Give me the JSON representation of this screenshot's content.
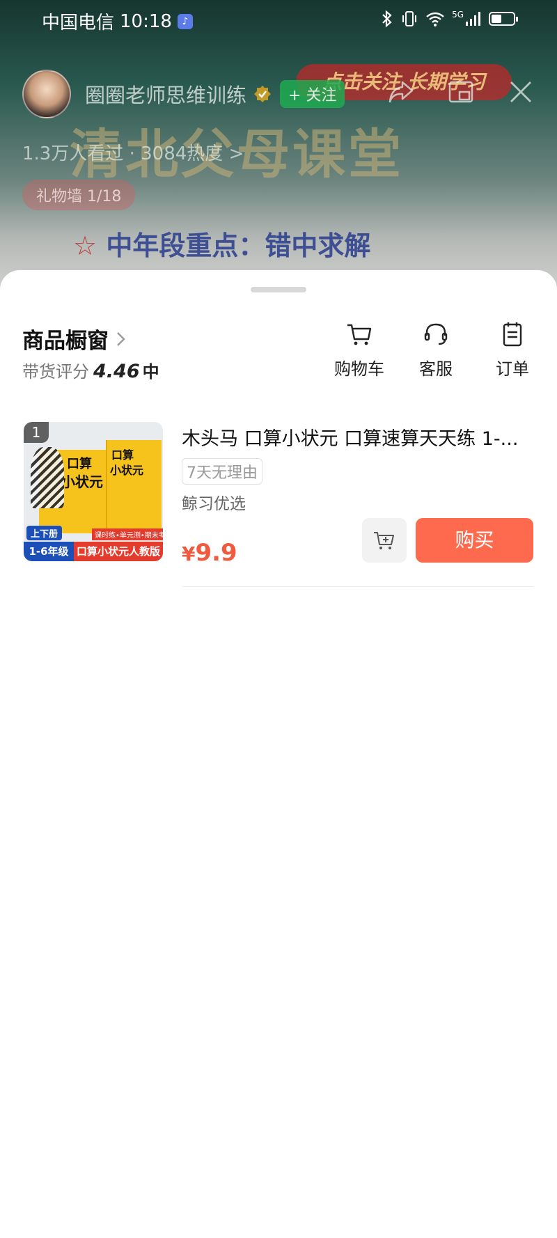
{
  "status_bar": {
    "carrier": "中国电信",
    "time": "10:18",
    "network": "5G"
  },
  "live": {
    "host_name": "圈圈老师思维训练",
    "follow_label": "+ 关注",
    "views": "1.3万人看过 · 3084热度",
    "views_chevron": ">",
    "gift_wall": "礼物墙 1/18",
    "banner_title": "清北父母课堂",
    "banner_follow": "点击关注 长期学习",
    "banner_sub": "中年段重点：错中求解",
    "banner_star": "☆"
  },
  "store": {
    "title": "商品橱窗",
    "rating_label": "带货评分",
    "rating_score": "4.46",
    "rating_level": "中",
    "tools": [
      {
        "label": "购物车",
        "icon": "cart-icon"
      },
      {
        "label": "客服",
        "icon": "headset-icon"
      },
      {
        "label": "订单",
        "icon": "order-icon"
      }
    ]
  },
  "product": {
    "index": "1",
    "title": "木头马 口算小状元 口算速算天天练 1-...",
    "badge": "7天无理由",
    "shop": "鲸习优选",
    "price_symbol": "¥",
    "price": "9.9",
    "buy_label": "购买",
    "thumb": {
      "book_title_a": "口算",
      "book_title_b": "小状元",
      "volume": "上下册",
      "grade": "1-6年级",
      "edition": "口算小状元人教版",
      "tags": "课时练•单元测•期末考"
    }
  },
  "colors": {
    "buy": "#fe6a4e",
    "price": "#f05a3f",
    "follow": "#1eaa50"
  }
}
